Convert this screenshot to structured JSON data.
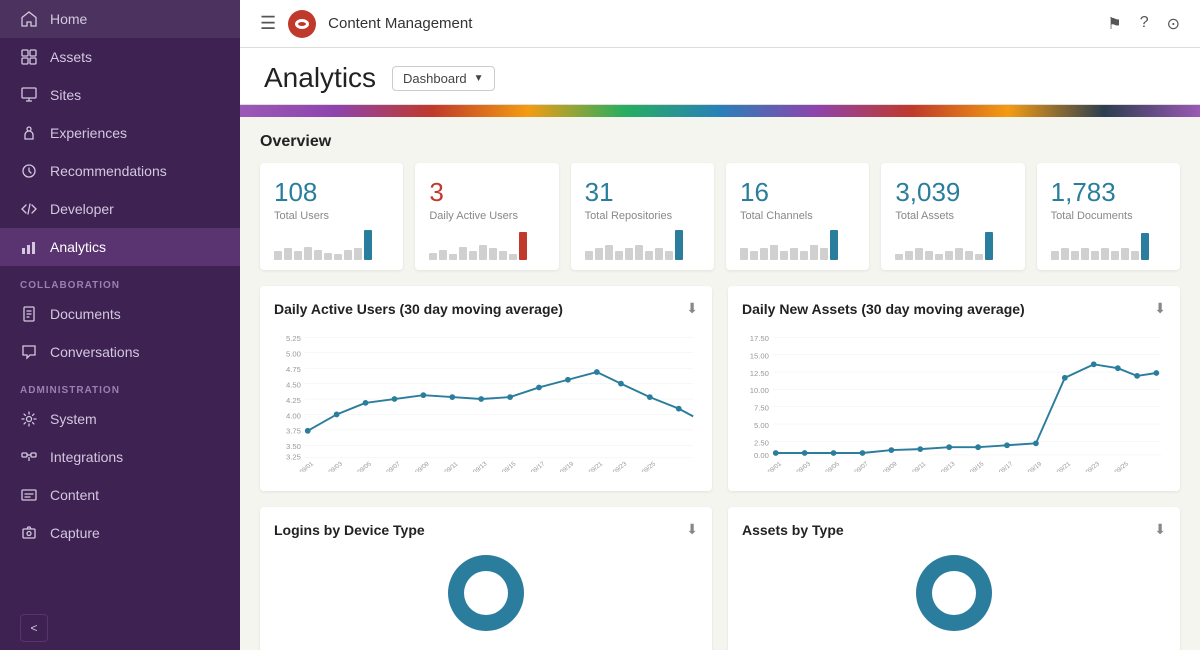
{
  "sidebar": {
    "items": [
      {
        "id": "home",
        "label": "Home",
        "icon": "home"
      },
      {
        "id": "assets",
        "label": "Assets",
        "icon": "box"
      },
      {
        "id": "sites",
        "label": "Sites",
        "icon": "grid"
      },
      {
        "id": "experiences",
        "label": "Experiences",
        "icon": "puzzle"
      },
      {
        "id": "recommendations",
        "label": "Recommendations",
        "icon": "bulb"
      },
      {
        "id": "developer",
        "label": "Developer",
        "icon": "code"
      },
      {
        "id": "analytics",
        "label": "Analytics",
        "icon": "chart",
        "active": true
      }
    ],
    "collaboration_label": "COLLABORATION",
    "collaboration_items": [
      {
        "id": "documents",
        "label": "Documents",
        "icon": "doc"
      },
      {
        "id": "conversations",
        "label": "Conversations",
        "icon": "chat"
      }
    ],
    "administration_label": "ADMINISTRATION",
    "admin_items": [
      {
        "id": "system",
        "label": "System",
        "icon": "gear"
      },
      {
        "id": "integrations",
        "label": "Integrations",
        "icon": "plug"
      },
      {
        "id": "content",
        "label": "Content",
        "icon": "content"
      },
      {
        "id": "capture",
        "label": "Capture",
        "icon": "capture"
      }
    ],
    "collapse_label": "<"
  },
  "topbar": {
    "app_title": "Content Management"
  },
  "page": {
    "title": "Analytics",
    "dropdown_label": "Dashboard"
  },
  "overview": {
    "section_title": "Overview",
    "stats": [
      {
        "value": "108",
        "label": "Total Users",
        "color": "teal",
        "bars": [
          3,
          4,
          3,
          5,
          4,
          3,
          2,
          4,
          5,
          18
        ]
      },
      {
        "value": "3",
        "label": "Daily Active Users",
        "color": "red",
        "bars": [
          2,
          3,
          2,
          4,
          3,
          5,
          4,
          3,
          2,
          9
        ]
      },
      {
        "value": "31",
        "label": "Total Repositories",
        "color": "teal",
        "bars": [
          3,
          4,
          5,
          3,
          4,
          5,
          3,
          4,
          3,
          15
        ]
      },
      {
        "value": "16",
        "label": "Total Channels",
        "color": "teal",
        "bars": [
          4,
          3,
          4,
          5,
          3,
          4,
          3,
          5,
          4,
          16
        ]
      },
      {
        "value": "3,039",
        "label": "Total Assets",
        "color": "teal",
        "bars": [
          2,
          3,
          4,
          3,
          2,
          3,
          4,
          3,
          2,
          15
        ]
      },
      {
        "value": "1,783",
        "label": "Total Documents",
        "color": "teal",
        "bars": [
          3,
          4,
          3,
          4,
          3,
          4,
          3,
          4,
          3,
          14
        ]
      }
    ]
  },
  "charts": {
    "daily_users": {
      "title": "Daily Active Users (30 day moving average)",
      "y_labels": [
        "5.25",
        "5.00",
        "4.75",
        "4.50",
        "4.25",
        "4.00",
        "3.75",
        "3.50",
        "3.25"
      ],
      "x_labels": [
        "09/01/2021",
        "09/03/2021",
        "09/05/2021",
        "09/07/2021",
        "09/09/2021",
        "09/11/2021",
        "09/13/2021",
        "09/15/2021",
        "09/17/2021",
        "09/19/2021",
        "09/21/2021",
        "09/23/2021",
        "09/25/2021"
      ]
    },
    "daily_assets": {
      "title": "Daily New Assets (30 day moving average)",
      "y_labels": [
        "17.50",
        "15.00",
        "12.50",
        "10.00",
        "7.50",
        "5.00",
        "2.50",
        "0.00"
      ],
      "x_labels": [
        "09/01/2021",
        "09/03/2021",
        "09/05/2021",
        "09/07/2021",
        "09/09/2021",
        "09/11/2021",
        "09/13/2021",
        "09/15/2021",
        "09/17/2021",
        "09/19/2021",
        "09/21/2021",
        "09/23/2021",
        "09/25/2021"
      ]
    },
    "logins_by_device": {
      "title": "Logins by Device Type"
    },
    "assets_by_type": {
      "title": "Assets by Type"
    }
  }
}
